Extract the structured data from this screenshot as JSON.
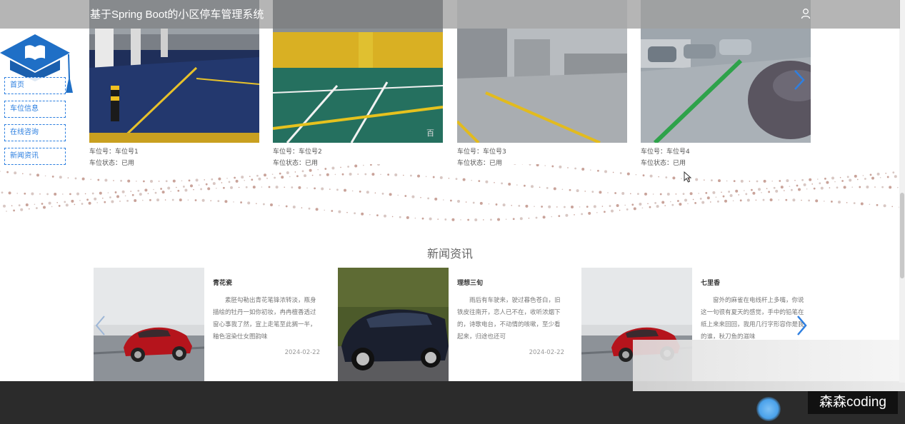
{
  "app": {
    "title": "基于Spring Boot的小区停车管理系统"
  },
  "sidenav": {
    "items": [
      {
        "label": "首页"
      },
      {
        "label": "车位信息"
      },
      {
        "label": "在线咨询"
      },
      {
        "label": "新闻资讯"
      }
    ]
  },
  "slots": [
    {
      "no_label": "车位号：",
      "no": "车位号1",
      "status_label": "车位状态：",
      "status": "已用"
    },
    {
      "no_label": "车位号：",
      "no": "车位号2",
      "status_label": "车位状态：",
      "status": "已用"
    },
    {
      "no_label": "车位号：",
      "no": "车位号3",
      "status_label": "车位状态：",
      "status": "已用"
    },
    {
      "no_label": "车位号：",
      "no": "车位号4",
      "status_label": "车位状态：",
      "status": "已用"
    }
  ],
  "news": {
    "title": "新闻资讯",
    "items": [
      {
        "title": "青花瓷",
        "body": "素胚勾勒出青花笔锋浓转淡，瓶身描绘的牡丹一如你初妆，冉冉檀香透过窗心事我了然，宣上走笔至此搁一半，釉色渲染仕女图韵味",
        "date": "2024-02-22"
      },
      {
        "title": "理想三旬",
        "body": "雨后有车驶来，驶过暮色苍白，旧铁皮往南开，恋人已不在，收听浓烟下的，诗歌电台，不动情的咳嗽，至少看起来，归途也还可",
        "date": "2024-02-22"
      },
      {
        "title": "七里香",
        "body": "窗外的麻雀在电线杆上多嘴，你说这一句很有夏天的感觉，手中的铅笔在纸上来来回回，我用几行字形容你是我的谁，秋刀鱼的滋味",
        "date": ""
      }
    ]
  },
  "watermark": "森森coding",
  "colors": {
    "accent": "#2c7fe0",
    "footer": "#2b2b2b"
  },
  "icons": {
    "user": "user-icon",
    "next": "chevron-right-icon",
    "prev": "chevron-left-icon",
    "logo": "graduation-cap-book-icon"
  }
}
